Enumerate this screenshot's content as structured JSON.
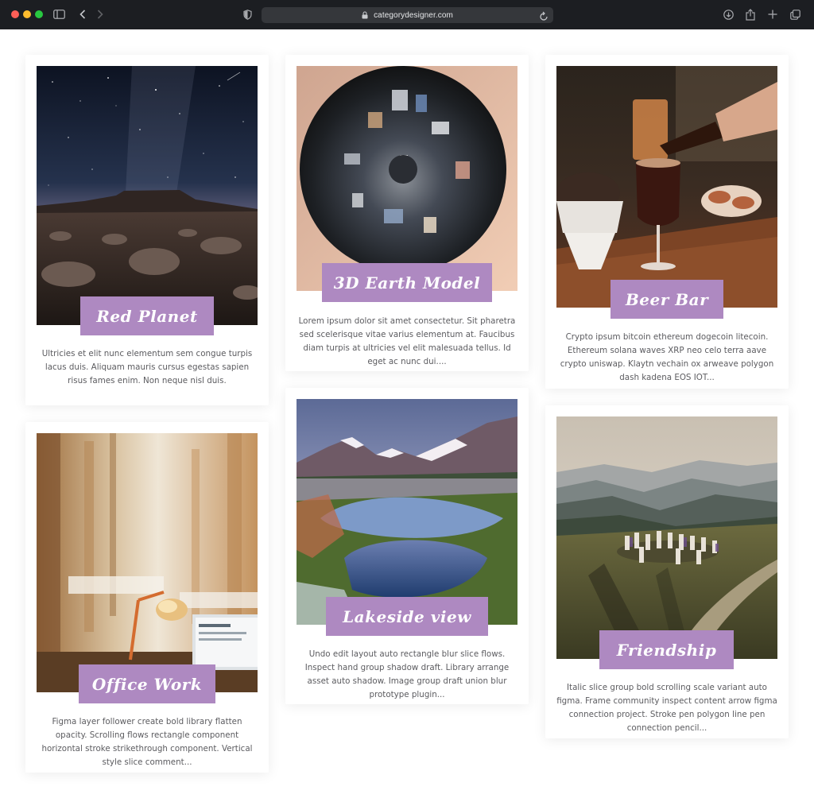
{
  "browser": {
    "url": "categorydesigner.com",
    "icons": [
      "sidebar-icon",
      "back-icon",
      "forward-icon",
      "shield-icon",
      "lock-icon",
      "reload-icon",
      "download-icon",
      "share-icon",
      "new-tab-icon",
      "tabs-icon"
    ]
  },
  "colors": {
    "label_background": "#ae89c1",
    "label_text": "#ffffff",
    "description_text": "#5c5c60",
    "page_background": "#ffffff"
  },
  "cards": [
    {
      "title": "Red Planet",
      "description": "Ultricies et elit nunc elementum sem congue turpis lacus duis. Aliquam mauris cursus egestas sapien risus fames enim. Non neque nisl duis."
    },
    {
      "title": "3D Earth Model",
      "description": "Lorem ipsum dolor sit amet consectetur. Sit pharetra sed scelerisque vitae varius elementum at. Faucibus diam turpis at ultricies vel elit malesuada tellus. Id eget ac nunc dui...."
    },
    {
      "title": "Beer Bar",
      "description": "Crypto ipsum bitcoin ethereum dogecoin litecoin. Ethereum solana waves XRP neo celo terra aave crypto uniswap. Klaytn vechain ox arweave polygon dash kadena EOS IOT..."
    },
    {
      "title": "Office Work",
      "description": "Figma layer follower create bold library flatten opacity. Scrolling flows rectangle component horizontal stroke strikethrough component. Vertical style slice comment..."
    },
    {
      "title": "Lakeside view",
      "description": "Undo edit layout auto rectangle blur slice flows. Inspect hand group shadow draft. Library arrange asset auto shadow. Image group draft union blur prototype plugin..."
    },
    {
      "title": "Friendship",
      "description": "Italic slice group bold scrolling scale variant auto figma. Frame community inspect content arrow figma connection project. Stroke pen polygon line pen connection pencil..."
    }
  ]
}
